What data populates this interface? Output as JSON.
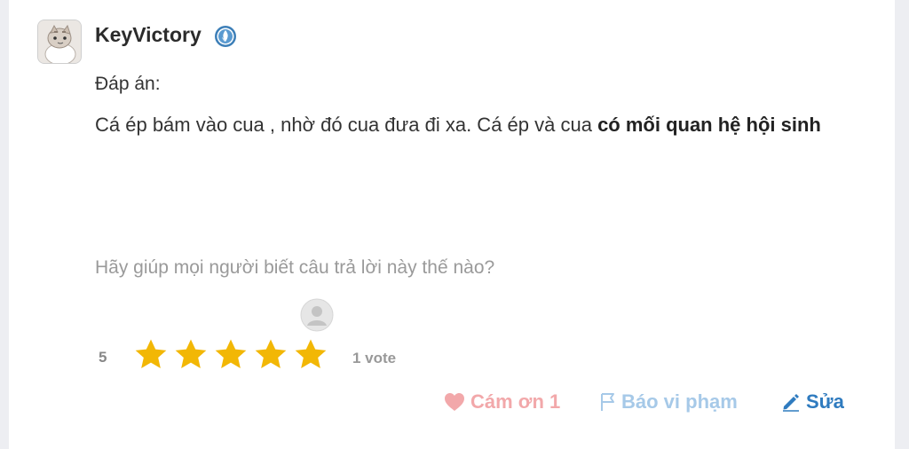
{
  "user": {
    "name": "KeyVictory"
  },
  "answer": {
    "label": "Đáp án:",
    "text_plain": "Cá ép bám vào cua , nhờ đó cua đưa đi xa. Cá ép và cua ",
    "text_bold": "có mối quan hệ hội sinh"
  },
  "rating": {
    "prompt": "Hãy giúp mọi người biết câu trả lời này thế nào?",
    "score": "5",
    "stars_filled": 5,
    "stars_total": 5,
    "vote_count": "1 vote"
  },
  "actions": {
    "thank_label": "Cám ơn 1",
    "report_label": "Báo vi phạm",
    "edit_label": "Sửa"
  },
  "colors": {
    "star": "#f2b705",
    "thank": "#f2a8aa",
    "report": "#a6c9e8",
    "edit": "#2f7bbf"
  },
  "icons": [
    "verified-badge-icon",
    "heart-icon",
    "flag-icon",
    "pencil-icon"
  ]
}
